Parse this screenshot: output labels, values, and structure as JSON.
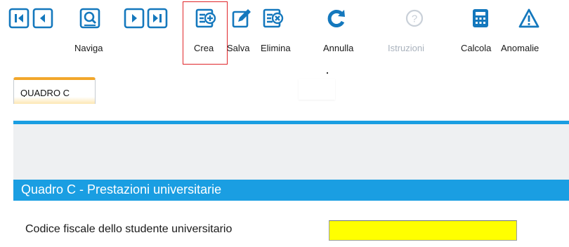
{
  "toolbar": {
    "navigate_label": "Naviga",
    "create_label": "Crea",
    "save_label": "Salva",
    "delete_label": "Elimina",
    "cancel_label": "Annulla",
    "instructions_label": "Istruzioni",
    "calculate_label": "Calcola",
    "anomalies_label": "Anomalie",
    "icons": [
      "first-record-icon",
      "previous-record-icon",
      "search-record-icon",
      "next-record-icon",
      "last-record-icon",
      "create-icon",
      "save-icon",
      "delete-icon",
      "undo-icon",
      "help-icon",
      "calculator-icon",
      "warning-icon"
    ],
    "icon_color": "#1478bd",
    "disabled_color": "#a9b2bd"
  },
  "tabs": [
    {
      "label": "QUADRO C",
      "active": true
    }
  ],
  "section": {
    "title": "Quadro C - Prestazioni universitarie",
    "header_color": "#1a9ee2"
  },
  "form": {
    "student_tax_code_label": "Codice fiscale dello studente universitario",
    "student_tax_code_value": "",
    "field_color": "#ffff00"
  }
}
